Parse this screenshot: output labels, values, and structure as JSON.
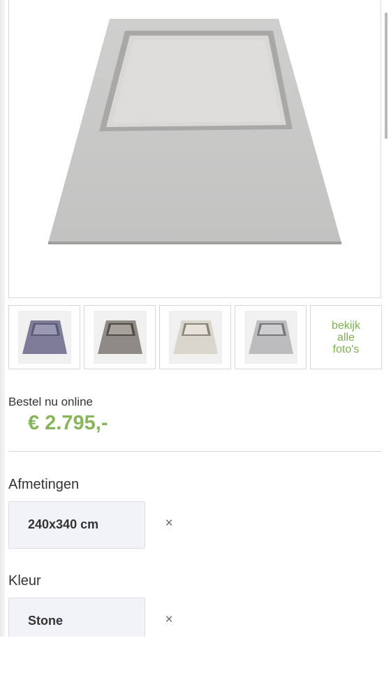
{
  "gallery": {
    "main_image": "rug-product-photo",
    "thumbnails": [
      {
        "name": "rug-thumbnail-1",
        "color": "#7e7c98"
      },
      {
        "name": "rug-thumbnail-2",
        "color": "#8b8782"
      },
      {
        "name": "rug-thumbnail-3",
        "color": "#d7d4cc"
      },
      {
        "name": "rug-thumbnail-4",
        "color": "#b8b8ba"
      }
    ],
    "more_link": {
      "line1": "bekijk",
      "line2": "alle",
      "line3": "foto's"
    }
  },
  "pricing": {
    "order_label": "Bestel nu online",
    "price": "€ 2.795,-",
    "price_color": "#86b55b"
  },
  "options": {
    "size": {
      "label": "Afmetingen",
      "value": "240x340 cm",
      "clear_icon": "×"
    },
    "color": {
      "label": "Kleur",
      "value": "Stone",
      "clear_icon": "×"
    }
  }
}
